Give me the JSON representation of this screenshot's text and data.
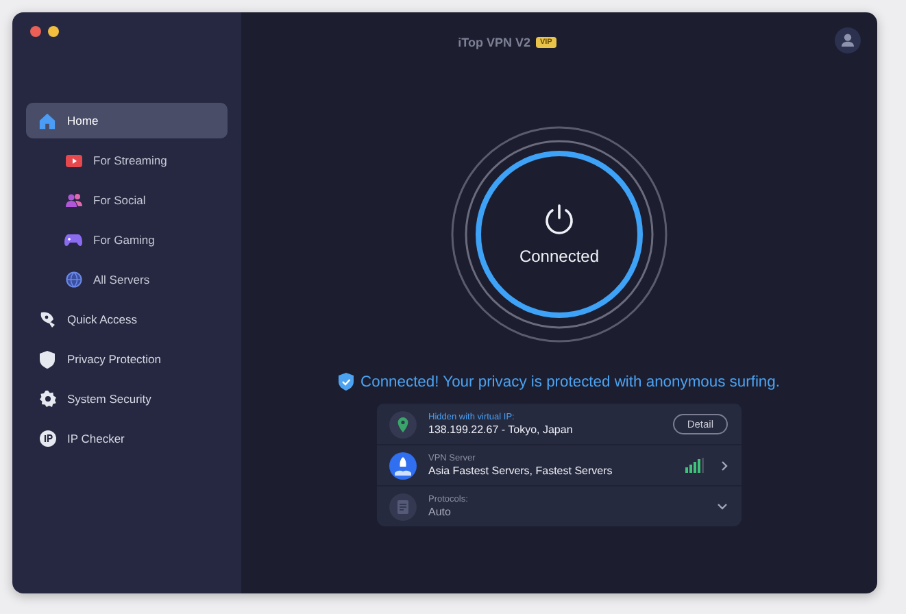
{
  "window": {
    "title": "iTop VPN V2",
    "badge": "VIP"
  },
  "sidebar": {
    "items": [
      {
        "label": "Home",
        "kind": "main",
        "selected": true
      },
      {
        "label": "For Streaming",
        "kind": "sub",
        "selected": false
      },
      {
        "label": "For Social",
        "kind": "sub",
        "selected": false
      },
      {
        "label": "For Gaming",
        "kind": "sub",
        "selected": false
      },
      {
        "label": "All Servers",
        "kind": "sub",
        "selected": false
      },
      {
        "label": "Quick Access",
        "kind": "main",
        "selected": false
      },
      {
        "label": "Privacy Protection",
        "kind": "main",
        "selected": false
      },
      {
        "label": "System Security",
        "kind": "main",
        "selected": false
      },
      {
        "label": "IP Checker",
        "kind": "main",
        "selected": false
      }
    ]
  },
  "status": {
    "connected": true,
    "label": "Connected",
    "message": "Connected! Your privacy is protected with anonymous surfing."
  },
  "info": [
    {
      "kind": "ip",
      "caption": "Hidden with virtual IP:",
      "value": "138.199.22.67 - Tokyo, Japan",
      "action": "Detail"
    },
    {
      "kind": "server",
      "caption": "VPN Server",
      "value": "Asia Fastest Servers, Fastest Servers"
    },
    {
      "kind": "protocol",
      "caption": "Protocols:",
      "value": "Auto"
    }
  ]
}
